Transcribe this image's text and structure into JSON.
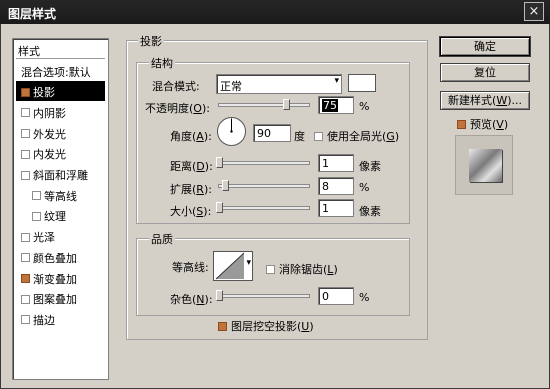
{
  "window": {
    "title": "图层样式",
    "close_glyph": "×"
  },
  "style_list": {
    "header": "样式",
    "items": [
      {
        "label": "混合选项:默认",
        "checkbox": "none",
        "selected": false,
        "sub": false
      },
      {
        "label": "投影",
        "checkbox": "checked",
        "selected": true,
        "sub": false
      },
      {
        "label": "内阴影",
        "checkbox": "empty",
        "selected": false,
        "sub": false
      },
      {
        "label": "外发光",
        "checkbox": "empty",
        "selected": false,
        "sub": false
      },
      {
        "label": "内发光",
        "checkbox": "empty",
        "selected": false,
        "sub": false
      },
      {
        "label": "斜面和浮雕",
        "checkbox": "empty",
        "selected": false,
        "sub": false
      },
      {
        "label": "等高线",
        "checkbox": "empty",
        "selected": false,
        "sub": true
      },
      {
        "label": "纹理",
        "checkbox": "empty",
        "selected": false,
        "sub": true
      },
      {
        "label": "光泽",
        "checkbox": "empty",
        "selected": false,
        "sub": false
      },
      {
        "label": "颜色叠加",
        "checkbox": "empty",
        "selected": false,
        "sub": false
      },
      {
        "label": "渐变叠加",
        "checkbox": "checked",
        "selected": false,
        "sub": false
      },
      {
        "label": "图案叠加",
        "checkbox": "empty",
        "selected": false,
        "sub": false
      },
      {
        "label": "描边",
        "checkbox": "empty",
        "selected": false,
        "sub": false
      }
    ]
  },
  "drop_shadow": {
    "group_title": "投影",
    "structure_title": "结构",
    "blend_mode_label": "混合模式:",
    "blend_mode_value": "正常",
    "opacity_label_a": "不透明度(",
    "opacity_key": "O",
    "opacity_label_b": "):",
    "opacity_value": "75",
    "opacity_unit": "%",
    "opacity_fraction": 0.75,
    "angle_label_a": "角度(",
    "angle_key": "A",
    "angle_label_b": "):",
    "angle_value": "90",
    "angle_unit": "度",
    "global_light_label_a": "使用全局光(",
    "global_light_key": "G",
    "global_light_label_b": ")",
    "distance_label_a": "距离(",
    "distance_key": "D",
    "distance_label_b": "):",
    "distance_value": "1",
    "distance_unit": "像素",
    "spread_label_a": "扩展(",
    "spread_key": "R",
    "spread_label_b": "):",
    "spread_value": "8",
    "spread_unit": "%",
    "size_label_a": "大小(",
    "size_key": "S",
    "size_label_b": "):",
    "size_value": "1",
    "size_unit": "像素",
    "quality_title": "品质",
    "contour_label": "等高线:",
    "anti_alias_label_a": "消除锯齿(",
    "anti_alias_key": "L",
    "anti_alias_label_b": ")",
    "noise_label_a": "杂色(",
    "noise_key": "N",
    "noise_label_b": "):",
    "noise_value": "0",
    "noise_unit": "%",
    "knockout_label_a": "图层挖空投影(",
    "knockout_key": "U",
    "knockout_label_b": ")"
  },
  "buttons": {
    "ok": "确定",
    "reset": "复位",
    "new_style_a": "新建样式(",
    "new_style_key": "W",
    "new_style_b": ")...",
    "preview_a": "预览(",
    "preview_key": "V",
    "preview_b": ")"
  },
  "colors": {
    "checked_accent": "#c0743a",
    "shadow_color_swatch": "#ffffff",
    "titlebar": "#1f1f1f"
  }
}
